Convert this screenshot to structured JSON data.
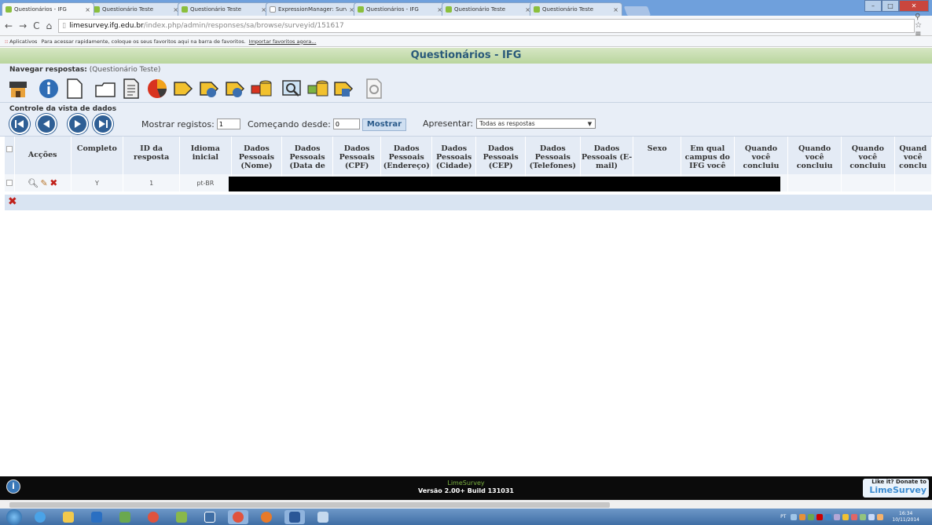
{
  "browser": {
    "tabs": [
      {
        "title": "Questionários - IFG",
        "active": true
      },
      {
        "title": "Questionário Teste",
        "active": false
      },
      {
        "title": "Questionário Teste",
        "active": false
      },
      {
        "title": "ExpressionManager: Surve",
        "active": false
      },
      {
        "title": "Questionários - IFG",
        "active": false
      },
      {
        "title": "Questionário Teste",
        "active": false
      },
      {
        "title": "Questionário Teste",
        "active": false
      }
    ],
    "url_host": "limesurvey.ifg.edu.br",
    "url_path": "/index.php/admin/responses/sa/browse/surveyid/151617",
    "bookmarks_apps": "Aplicativos",
    "bookmarks_hint": "Para acessar rapidamente, coloque os seus favoritos aqui na barra de favoritos.",
    "bookmarks_import": "Importar favoritos agora..."
  },
  "page": {
    "title": "Questionários - IFG",
    "nav_label": "Navegar respostas:",
    "nav_survey": "(Questionário Teste)",
    "control_label": "Controle da vista de dados",
    "show_records_label": "Mostrar registos:",
    "show_records_value": "1",
    "starting_from_label": "Começando desde:",
    "starting_from_value": "0",
    "show_button": "Mostrar",
    "present_label": "Apresentar:",
    "present_value": "Todas as respostas"
  },
  "toolbar_icons": [
    "home-icon",
    "info-icon",
    "page-icon",
    "folder-icon",
    "document-icon",
    "pie-chart-icon",
    "export-icon",
    "export-spss-icon",
    "export-r-icon",
    "import-db-icon",
    "view-saved-icon",
    "import-vv-icon",
    "export-vv-icon",
    "iterate-icon"
  ],
  "table": {
    "headers": [
      "Acções",
      "Completo",
      "ID da resposta",
      "Idioma inicial",
      "Dados Pessoais (Nome)",
      "Dados Pessoais (Data de",
      "Dados Pessoais (CPF)",
      "Dados Pessoais (Endereço)",
      "Dados Pessoais (Cidade)",
      "Dados Pessoais (CEP)",
      "Dados Pessoais (Telefones)",
      "Dados Pessoais (E-mail)",
      "Sexo",
      "Em qual campus do IFG você",
      "Quando você concluiu",
      "Quando você concluiu",
      "Quando você concluiu",
      "Quand você conclu"
    ],
    "rows": [
      {
        "completo": "Y",
        "id": "1",
        "idioma": "pt-BR"
      }
    ]
  },
  "footer": {
    "brand": "LimeSurvey",
    "version": "Versão 2.00+ Build 131031",
    "donate_top": "Like it? Donate to",
    "donate_brand": "LimeSurvey"
  },
  "taskbar": {
    "lang": "PT",
    "time": "16:34",
    "date": "10/11/2014"
  }
}
